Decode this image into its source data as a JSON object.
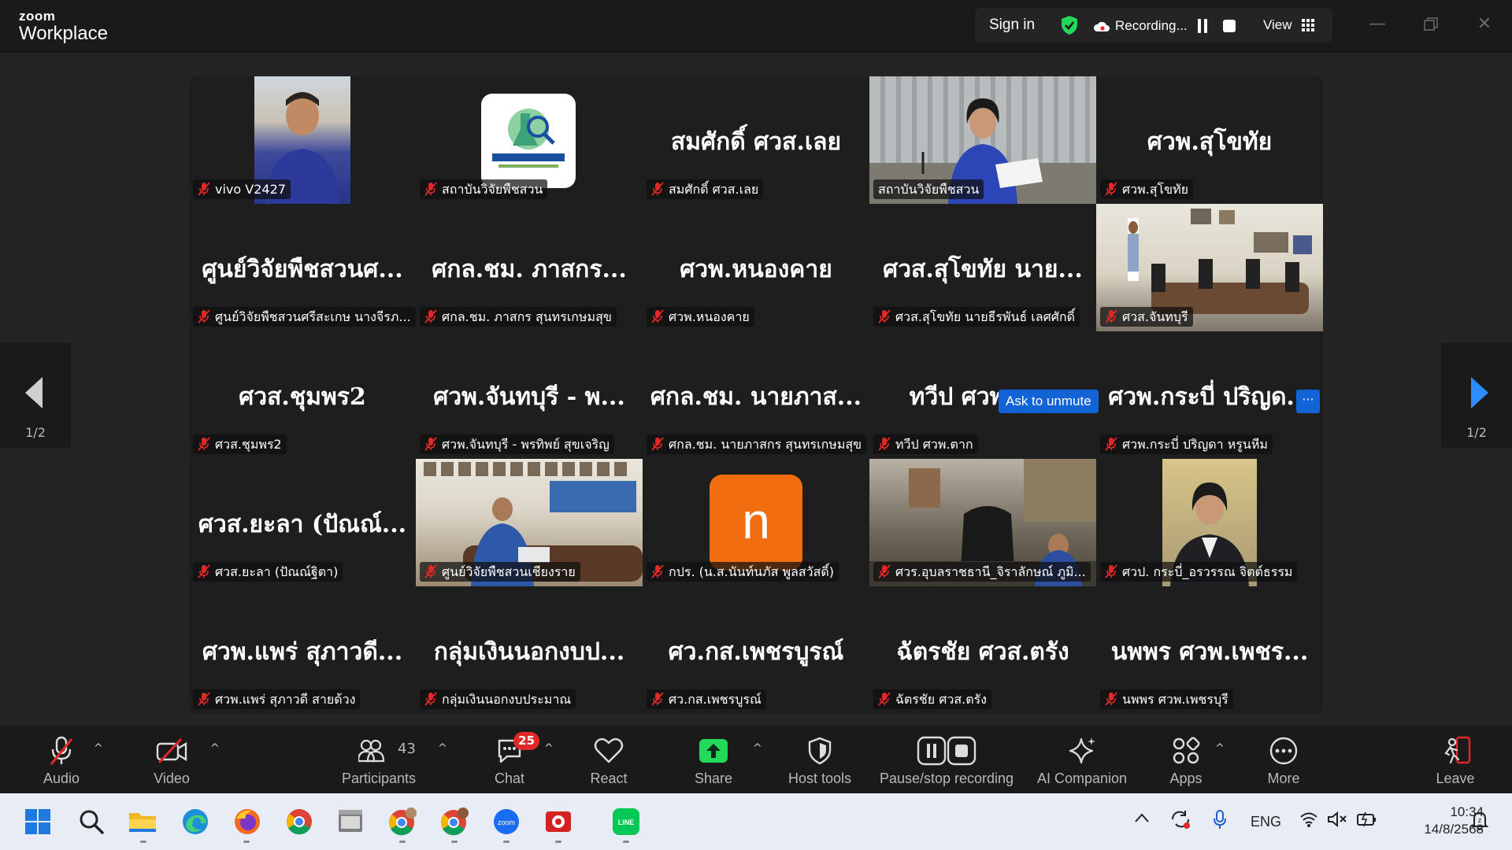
{
  "app": {
    "brand_top": "zoom",
    "brand_bottom": "Workplace"
  },
  "header": {
    "sign_in": "Sign in",
    "recording": "Recording...",
    "view": "View"
  },
  "colors": {
    "active_speaker": "#23d959",
    "accent": "#1163d6",
    "badge": "#e02828",
    "share_green": "#23d959"
  },
  "pager": {
    "page_label": "1/2"
  },
  "tiles": [
    {
      "big": "",
      "name": "vivo V2427",
      "kind": "video-person"
    },
    {
      "big": "",
      "name": "สถาบันวิจัยพืชสวน",
      "kind": "logo"
    },
    {
      "big": "สมศักดิ์ ศวส.เลย",
      "name": "สมศักดิ์ ศวส.เลย",
      "kind": "text"
    },
    {
      "big": "",
      "name": "สถาบันวิจัยพืชสวน",
      "kind": "video-speaker"
    },
    {
      "big": "ศวพ.สุโขทัย",
      "name": "ศวพ.สุโขทัย",
      "kind": "text"
    },
    {
      "big": "ศูนย์วิจัยพืชสวนศ...",
      "name": "ศูนย์วิจัยพืชสวนศรีสะเกษ นางจีรภ...",
      "kind": "text"
    },
    {
      "big": "ศกล.ชม. ภาสกร...",
      "name": "ศกล.ชม. ภาสกร สุนทรเกษมสุข",
      "kind": "text"
    },
    {
      "big": "ศวพ.หนองคาย",
      "name": "ศวพ.หนองคาย",
      "kind": "text"
    },
    {
      "big": "ศวส.สุโขทัย นาย...",
      "name": "ศวส.สุโขทัย นายธีรพันธ์ เลศศักดิ์",
      "kind": "text"
    },
    {
      "big": "",
      "name": "ศวส.จันทบุรี",
      "kind": "video-room"
    },
    {
      "big": "ศวส.ชุมพร2",
      "name": "ศวส.ชุมพร2",
      "kind": "text"
    },
    {
      "big": "ศวพ.จันทบุรี - พ...",
      "name": "ศวพ.จันทบุรี - พรทิพย์ สุขเจริญ",
      "kind": "text"
    },
    {
      "big": "ศกล.ชม. นายภาส...",
      "name": "ศกล.ชม. นายภาสกร สุนทรเกษมสุข",
      "kind": "text"
    },
    {
      "big": "ทวีป ศวพ.ตาก",
      "name": "ทวีป ศวพ.ตาก",
      "kind": "text"
    },
    {
      "big": "ศวพ.กระบี่ ปริญด...",
      "name": "ศวพ.กระบี่ ปริญดา หรูนหีม",
      "kind": "text"
    },
    {
      "big": "ศวส.ยะลา (ปัณณ์...",
      "name": "ศวส.ยะลา (ปัณณ์ฐิตา)",
      "kind": "text"
    },
    {
      "big": "",
      "name": "ศูนย์วิจัยพืชสวนเชียงราย",
      "kind": "video-meeting"
    },
    {
      "big": "",
      "name": "กปร. (น.ส.นันท์นภัส พูลสวัสดิ์)",
      "kind": "avatar-n"
    },
    {
      "big": "",
      "name": "ศวร.อุบลราชธานี_จิราลักษณ์ ภูมิ...",
      "kind": "video-office"
    },
    {
      "big": "",
      "name": "ศวป. กระบี่_อรวรรณ จิตต์ธรรม",
      "kind": "video-woman"
    },
    {
      "big": "ศวพ.แพร่ สุภาวดี...",
      "name": "ศวพ.แพร่ สุภาวดี สายด้วง",
      "kind": "text"
    },
    {
      "big": "กลุ่มเงินนอกงบป...",
      "name": "กลุ่มเงินนอกงบประมาณ",
      "kind": "text"
    },
    {
      "big": "ศว.กส.เพชรบูรณ์",
      "name": "ศว.กส.เพชรบูรณ์",
      "kind": "text"
    },
    {
      "big": "ฉัตรชัย ศวส.ตรัง",
      "name": "ฉัตรชัย ศวส.ตรัง",
      "kind": "text"
    },
    {
      "big": "นพพร ศวพ.เพชร...",
      "name": "นพพร ศวพ.เพชรบุรี",
      "kind": "text"
    }
  ],
  "tile_overlay": {
    "ask_to_unmute": "Ask to unmute",
    "more": "···"
  },
  "avatar_letter": "n",
  "toolbar": {
    "audio": "Audio",
    "video": "Video",
    "participants": "Participants",
    "participants_count": "43",
    "chat": "Chat",
    "chat_badge": "25",
    "react": "React",
    "share": "Share",
    "host_tools": "Host tools",
    "pause_stop": "Pause/stop recording",
    "ai_companion": "AI Companion",
    "apps": "Apps",
    "more": "More",
    "leave": "Leave"
  },
  "taskbar": {
    "lang": "ENG",
    "time": "10:34",
    "date": "14/8/2568",
    "apps": [
      "start-icon",
      "search-icon",
      "file-explorer-icon",
      "edge-icon",
      "firefox-icon",
      "chrome-icon",
      "file-manager-icon",
      "chrome-profile-icon",
      "chrome-profile-2-icon",
      "zoom-icon",
      "screen-recorder-icon",
      "line-icon"
    ]
  }
}
